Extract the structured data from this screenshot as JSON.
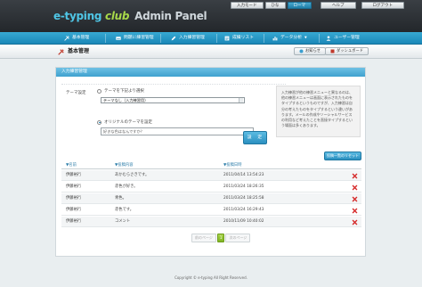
{
  "header": {
    "logo_main": "e-typing",
    "logo_club": "club",
    "logo_panel": "Admin Panel",
    "top_buttons": [
      "入力モード",
      "ひな",
      "ローマ",
      "ヘルプ",
      "ログアウト"
    ]
  },
  "nav": {
    "items": [
      "基本管理",
      "問題に練習管理",
      "入力練習管理",
      "成績リスト",
      "データ分析",
      "ユーザー管理"
    ]
  },
  "subheader": {
    "title": "基本管理",
    "btn_notice": "お知らせ",
    "btn_dashboard": "ダッシュボード"
  },
  "panel": {
    "heading": "入力練習管理",
    "theme_label": "テーマ設定",
    "radio_select": "テーマを下記より選択",
    "select_value": "テーマなし（入力練習用）",
    "radio_custom": "オリジナルのテーマを設定",
    "custom_value": "好きな色はなんですか？",
    "help_text": "入力練習が他の練習メニューと異なるのは、他の練習メニューは画面に表示されたものをタイプするというものですが、入力練習は自分の考えたものをタイプするという違いがあります。メールの作成やソーシャルサービスの利用など考えたことを直接タイプするという場面は多くあります。",
    "submit_label": "設　定",
    "reset_label": "投稿一覧のリセット"
  },
  "table": {
    "headers": [
      "▼名前",
      "▼投稿内容",
      "▼投稿日時"
    ],
    "rows": [
      {
        "name": "伊藤裕行",
        "content": "あかむらさきです。",
        "date": "2011/04/14 13:54:23"
      },
      {
        "name": "伊藤裕行",
        "content": "赤色が好き。",
        "date": "2011/03/24 18:26:35"
      },
      {
        "name": "伊藤裕行",
        "content": "青色。",
        "date": "2011/03/24 18:25:58"
      },
      {
        "name": "伊藤裕行",
        "content": "赤色です。",
        "date": "2011/03/24 16:29:43"
      },
      {
        "name": "伊藤裕行",
        "content": "コメント",
        "date": "2010/11/09 10:40:02"
      }
    ]
  },
  "pager": {
    "prev": "前のページ",
    "current": "1",
    "next": "次のページ"
  },
  "footer": {
    "copyright": "Copyright © e-typing All Right Reserved."
  },
  "colors": {
    "accent_blue": "#1a87b8",
    "delete_red": "#d62b2b",
    "page_green": "#7fb522"
  }
}
